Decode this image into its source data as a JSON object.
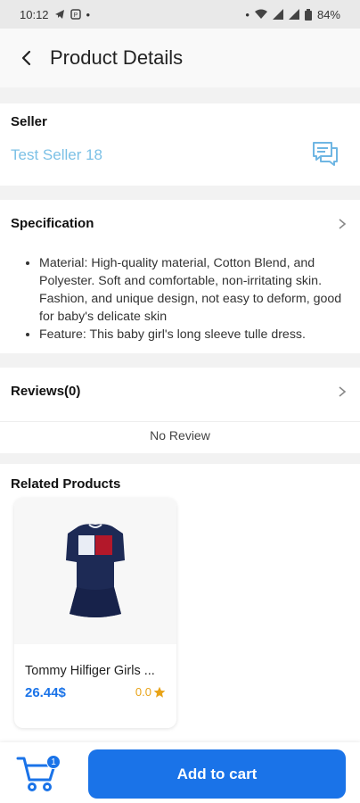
{
  "status_bar": {
    "time": "10:12",
    "battery": "84%"
  },
  "header": {
    "title": "Product Details"
  },
  "seller": {
    "label": "Seller",
    "name": "Test Seller 18"
  },
  "specification": {
    "label": "Specification",
    "items": [
      "Material: High-quality material, Cotton Blend, and Polyester. Soft and comfortable, non-irritating skin. Fashion, and unique design, not easy to deform, good for baby's delicate skin",
      "Feature: This baby girl's long sleeve tulle dress."
    ]
  },
  "reviews": {
    "label": "Reviews(0)",
    "empty_text": "No Review"
  },
  "related": {
    "label": "Related Products",
    "products": [
      {
        "name": "Tommy Hilfiger Girls ...",
        "price": "26.44$",
        "rating": "0.0"
      }
    ]
  },
  "cart": {
    "count": "1",
    "add_label": "Add to cart"
  },
  "colors": {
    "accent": "#1a73e8",
    "seller_link": "#7cc1e6",
    "star": "#e8a317"
  }
}
